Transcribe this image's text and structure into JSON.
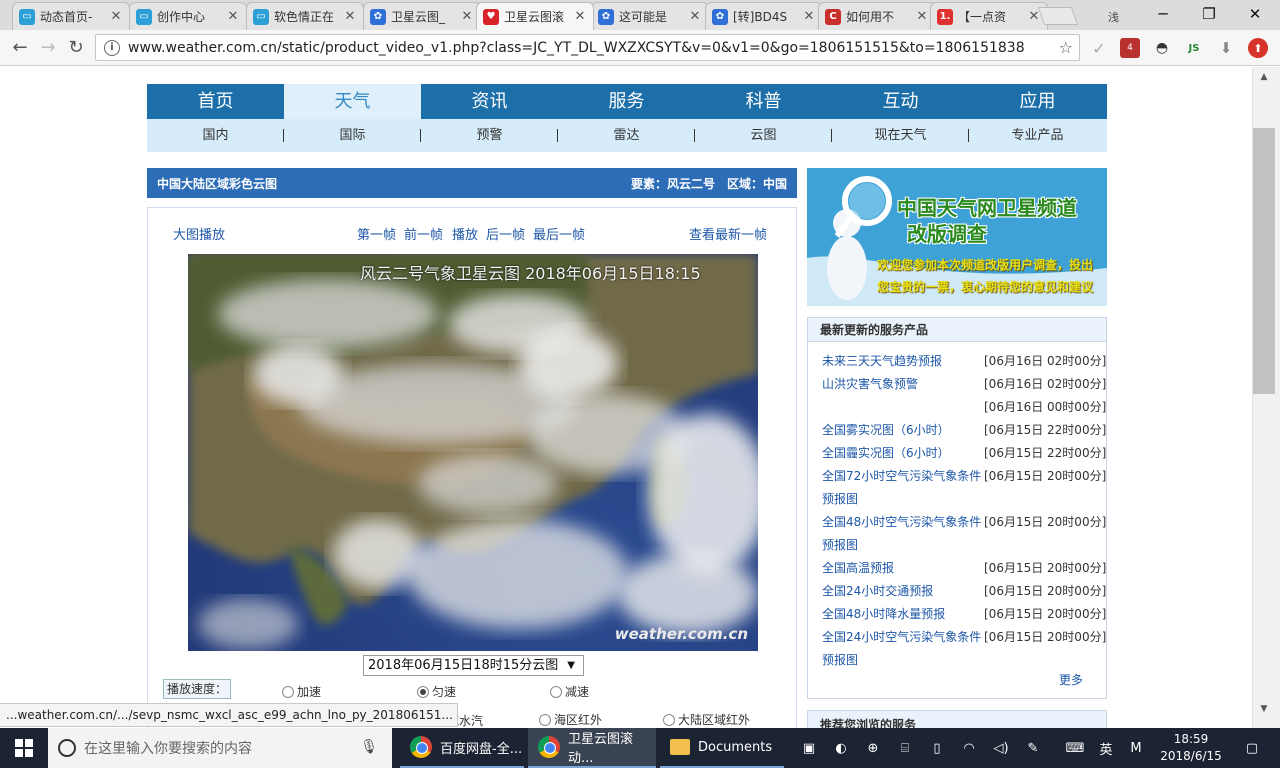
{
  "browser": {
    "tabs": [
      {
        "title": "动态首页-",
        "icon": "bilibili-tv-icon",
        "color": "#2b9fd6",
        "active": false
      },
      {
        "title": "创作中心",
        "icon": "bilibili-tv-icon",
        "color": "#2b9fd6",
        "active": false
      },
      {
        "title": "软色情正在",
        "icon": "bilibili-tv-icon",
        "color": "#2b9fd6",
        "active": false
      },
      {
        "title": "卫星云图_",
        "icon": "baidu-paw-icon",
        "color": "#2f6fd8",
        "active": false
      },
      {
        "title": "卫星云图滚",
        "icon": "weather-heart-icon",
        "color": "#d8232a",
        "active": true
      },
      {
        "title": "这可能是",
        "icon": "baidu-paw-icon",
        "color": "#2f6fd8",
        "active": false
      },
      {
        "title": "[转]BD4S",
        "icon": "baidu-paw-icon",
        "color": "#2f6fd8",
        "active": false
      },
      {
        "title": "如何用不",
        "icon": "csdn-c-icon",
        "color": "#c9302c",
        "active": false
      },
      {
        "title": "【一点资",
        "icon": "yidian-1-icon",
        "color": "#e0312f",
        "active": false
      }
    ],
    "profile_label": "浅",
    "url": "www.weather.com.cn/static/product_video_v1.php?class=JC_YT_DL_WXZXCSYT&v=0&v1=0&go=1806151515&to=1806151838",
    "ext_badge": "4",
    "ext_js": "JS",
    "status_url": "...weather.com.cn/.../sevp_nsmc_wxcl_asc_e99_achn_lno_py_201806151..."
  },
  "site": {
    "main_nav": [
      "首页",
      "天气",
      "资讯",
      "服务",
      "科普",
      "互动",
      "应用"
    ],
    "sub_nav": [
      "国内",
      "国际",
      "预警",
      "雷达",
      "云图",
      "现在天气",
      "专业产品"
    ],
    "panel_title": "中国大陆区域彩色云图",
    "panel_meta": "要素：风云二号　区域：中国",
    "controls": {
      "big_play": "大图播放",
      "first": "第一帧",
      "prev": "前一帧",
      "play": "播放",
      "next": "后一帧",
      "last": "最后一帧",
      "latest": "查看最新一帧"
    },
    "image_caption": "风云二号气象卫星云图 2018年06月15日18:15",
    "image_watermark": "weather.com.cn",
    "frame_select": "2018年06月15日18时15分云图",
    "speed_label": "播放速度：",
    "speed_options": [
      {
        "label": "加速",
        "selected": false
      },
      {
        "label": "匀速",
        "selected": true
      },
      {
        "label": "减速",
        "selected": false
      }
    ],
    "region_options": [
      {
        "label": "陆区域水汽",
        "selected": false
      },
      {
        "label": "海区红外",
        "selected": false
      },
      {
        "label": "大陆区域红外",
        "selected": false
      }
    ],
    "ad": {
      "line1": "中国天气网卫星频道",
      "line2": "改版调查",
      "line3": "欢迎您参加本次频道改版用户调查，投出您宝贵的一票，衷心期待您的意见和建议"
    },
    "products_title": "最新更新的服务产品",
    "products": [
      {
        "name": "未来三天天气趋势预报",
        "time": "[06月16日 02时00分]"
      },
      {
        "name": "山洪灾害气象预警",
        "time": "[06月16日 02时00分]"
      },
      {
        "name": "",
        "time": "[06月16日 00时00分]"
      },
      {
        "name": "全国雾实况图（6小时）",
        "time": "[06月15日 22时00分]"
      },
      {
        "name": "全国霾实况图（6小时）",
        "time": "[06月15日 22时00分]"
      },
      {
        "name": "全国72小时空气污染气象条件预报图",
        "time": "[06月15日 20时00分]"
      },
      {
        "name": "全国48小时空气污染气象条件预报图",
        "time": "[06月15日 20时00分]"
      },
      {
        "name": "全国高温预报",
        "time": "[06月15日 20时00分]"
      },
      {
        "name": "全国24小时交通预报",
        "time": "[06月15日 20时00分]"
      },
      {
        "name": "全国48小时降水量预报",
        "time": "[06月15日 20时00分]"
      },
      {
        "name": "全国24小时空气污染气象条件预报图",
        "time": "[06月15日 20时00分]"
      }
    ],
    "more": "更多",
    "recommend_title": "推荐您浏览的服务"
  },
  "taskbar": {
    "search_placeholder": "在这里输入你要搜索的内容",
    "tasks": [
      "百度网盘-全...",
      "卫星云图滚动...",
      "Documents"
    ],
    "ime": "英",
    "ime2": "M",
    "time": "18:59",
    "date": "2018/6/15"
  },
  "colors": {
    "nav_blue": "#1c6fa8",
    "panel_head": "#2d6db7",
    "link": "#1e57a8"
  }
}
